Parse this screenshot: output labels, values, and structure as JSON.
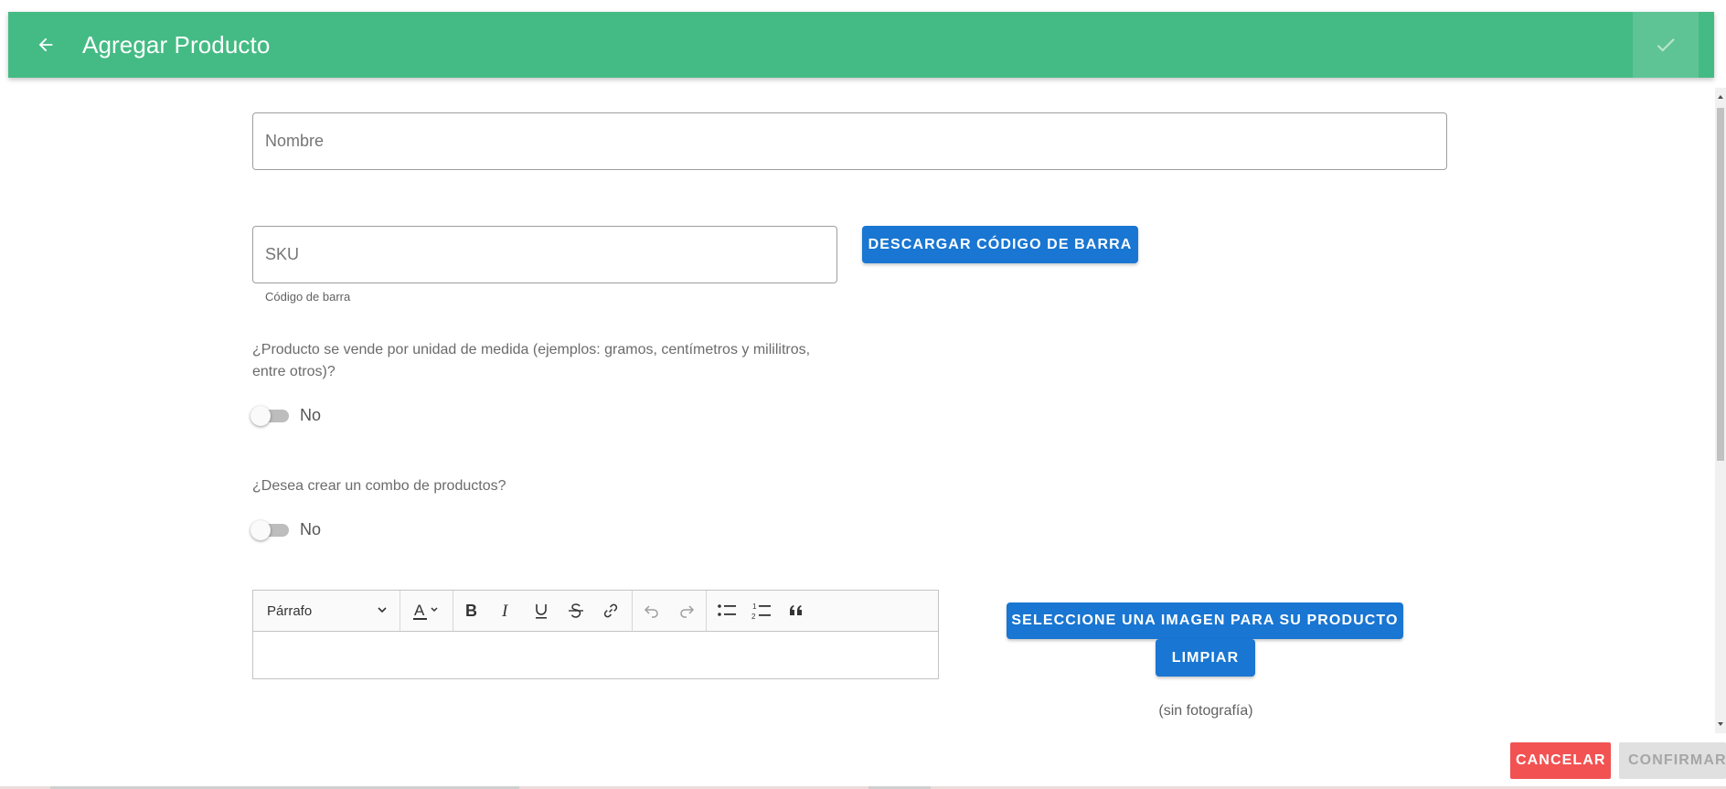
{
  "header": {
    "title": "Agregar Producto",
    "back_icon": "arrow-left-icon",
    "confirm_icon": "check-icon",
    "background_color": "#44bb84"
  },
  "form": {
    "name": {
      "placeholder": "Nombre",
      "value": ""
    },
    "sku": {
      "placeholder": "SKU",
      "value": "",
      "helper": "Código de barra"
    },
    "download_barcode_label": "DESCARGAR CÓDIGO DE BARRA",
    "unit_measure": {
      "question": "¿Producto se vende por unidad de medida (ejemplos: gramos, centímetros y mililitros, entre otros)?",
      "state": "No",
      "on": false
    },
    "combo": {
      "question": "¿Desea crear un combo de productos?",
      "state": "No",
      "on": false
    }
  },
  "editor": {
    "paragraph_style": "Párrafo",
    "tools": [
      "font-color-icon",
      "bold-icon",
      "italic-icon",
      "underline-icon",
      "strikethrough-icon",
      "link-icon",
      "undo-icon",
      "redo-icon",
      "bulleted-list-icon",
      "numbered-list-icon",
      "quote-icon"
    ]
  },
  "image": {
    "select_label": "SELECCIONE UNA IMAGEN PARA SU PRODUCTO",
    "clear_label": "LIMPIAR",
    "no_photo_text": "(sin fotografía)"
  },
  "footer": {
    "cancel_label": "CANCELAR",
    "confirm_label": "CONFIRMAR",
    "cancel_color": "#f25252"
  },
  "colors": {
    "primary_button": "#1976d2"
  }
}
